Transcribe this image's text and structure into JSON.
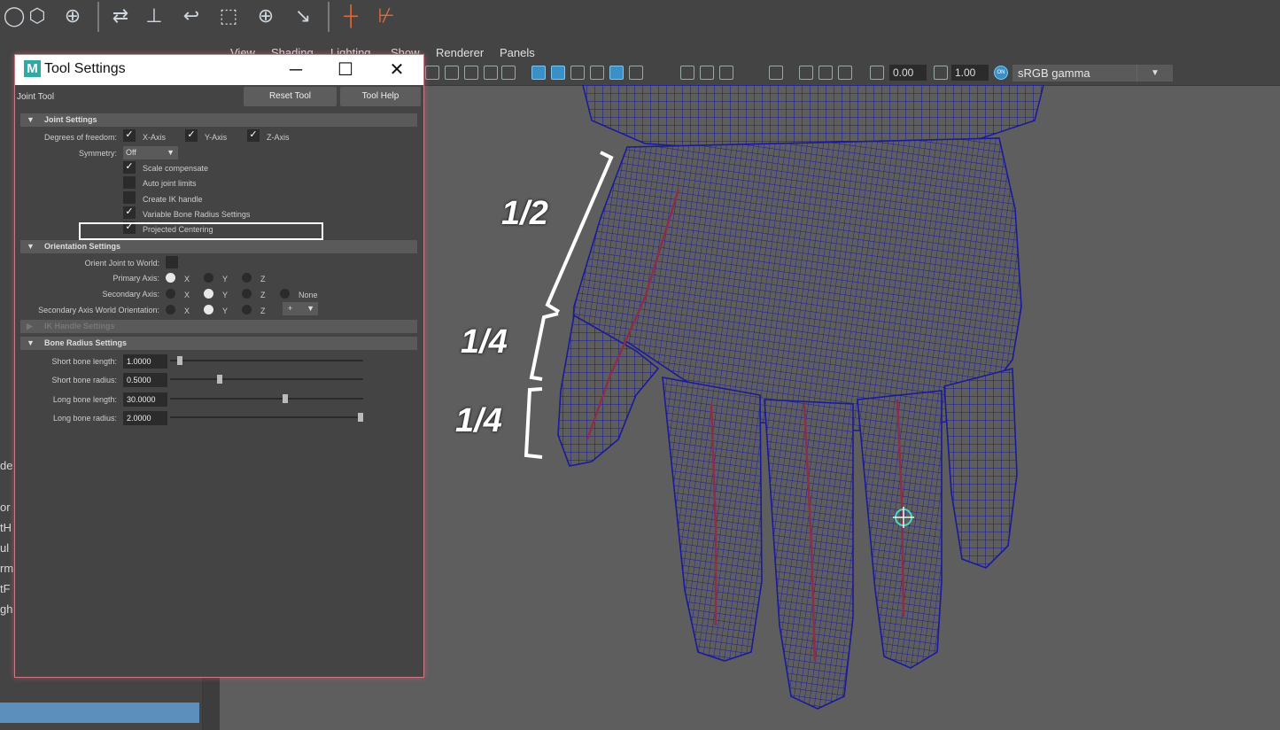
{
  "shelf": {
    "icons": [
      "joint-tool-icon",
      "bind-skin-icon",
      "paint-weights-icon",
      "mirror-joint-icon",
      "orient-joint-icon",
      "ik-handle-icon",
      "ik-spline-icon",
      "locator-icon",
      "connect-icon",
      "insert-joint-icon",
      "pin-icon"
    ]
  },
  "outliner": {
    "items": [
      "de",
      "",
      "or",
      "tH",
      "ul",
      "rm",
      "tF",
      "gh"
    ]
  },
  "viewport": {
    "menu": [
      "View",
      "Shading",
      "Lighting",
      "Show",
      "Renderer",
      "Panels"
    ],
    "exposure": "0.00",
    "gamma": "1.00",
    "colorspace": "sRGB gamma",
    "on_badge": "ON"
  },
  "annotations": {
    "half": "1/2",
    "quarter1": "1/4",
    "quarter2": "1/4"
  },
  "tool_settings": {
    "title": "Tool Settings",
    "tool_name": "Joint Tool",
    "reset_label": "Reset Tool",
    "help_label": "Tool Help",
    "joint_section": "Joint Settings",
    "dof_label": "Degrees of freedom:",
    "x_axis": "X-Axis",
    "y_axis": "Y-Axis",
    "z_axis": "Z-Axis",
    "symmetry_label": "Symmetry:",
    "symmetry_value": "Off",
    "scale_comp": "Scale compensate",
    "auto_limits": "Auto joint limits",
    "create_ik": "Create IK handle",
    "var_bone": "Variable Bone Radius Settings",
    "proj_center": "Projected Centering",
    "orient_section": "Orientation Settings",
    "orient_world": "Orient Joint to World:",
    "primary_axis": "Primary Axis:",
    "secondary_axis": "Secondary Axis:",
    "sec_world": "Secondary Axis World Orientation:",
    "x": "X",
    "y": "Y",
    "z": "Z",
    "none": "None",
    "sec_world_value": "+",
    "ik_section": "IK Handle Settings",
    "bone_section": "Bone Radius Settings",
    "short_len_label": "Short bone length:",
    "short_len": "1.0000",
    "short_rad_label": "Short bone radius:",
    "short_rad": "0.5000",
    "long_len_label": "Long bone length:",
    "long_len": "30.0000",
    "long_rad_label": "Long bone radius:",
    "long_rad": "2.0000",
    "sliders": {
      "short_len": 0.04,
      "short_rad": 0.25,
      "long_len": 0.6,
      "long_rad": 1.0
    }
  },
  "colors": {
    "accent": "#2fa8a6",
    "selection": "#5d8fbd",
    "wire": "#1a1a9a",
    "bone": "#8a2f4a"
  }
}
